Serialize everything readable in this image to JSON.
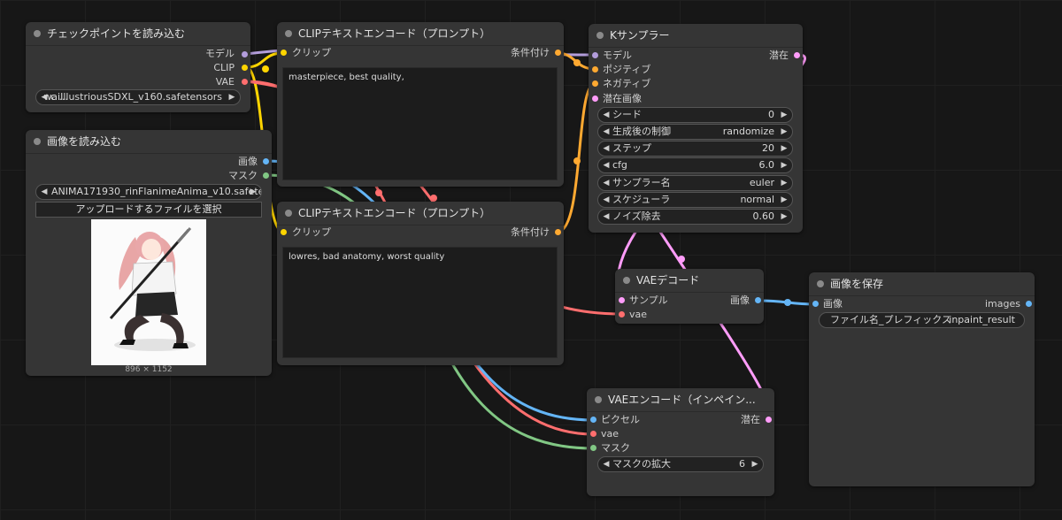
{
  "colors": {
    "model": "#b39ddb",
    "clip": "#ffd500",
    "vae": "#ff6e6e",
    "conditioning": "#ffa931",
    "latent": "#ff9cf9",
    "image": "#64b5f6",
    "mask": "#81c784"
  },
  "nodes": {
    "checkpoint": {
      "title": "チェックポイントを読み込む",
      "out_model": "モデル",
      "out_clip": "CLIP",
      "out_vae": "VAE",
      "ckpt_prefix": "c ...",
      "ckpt_value": "waiIllustriousSDXL_v160.safetensors"
    },
    "load_image": {
      "title": "画像を読み込む",
      "out_image": "画像",
      "out_mask": "マスク",
      "image_value": "ANIMA171930_rinFlanimeAnima_v10.safeten ...",
      "upload_label": "アップロードするファイルを選択",
      "caption": "896 × 1152"
    },
    "clip_pos": {
      "title": "CLIPテキストエンコード（プロンプト）",
      "in_clip": "クリップ",
      "out_cond": "条件付け",
      "text": "masterpiece, best quality,"
    },
    "clip_neg": {
      "title": "CLIPテキストエンコード（プロンプト）",
      "in_clip": "クリップ",
      "out_cond": "条件付け",
      "text": "lowres, bad anatomy, worst quality"
    },
    "ksampler": {
      "title": "Kサンプラー",
      "in_model": "モデル",
      "in_pos": "ポジティブ",
      "in_neg": "ネガティブ",
      "in_latent": "潜在画像",
      "out_latent": "潜在",
      "widgets": [
        {
          "label": "シード",
          "value": "0"
        },
        {
          "label": "生成後の制御",
          "value": "randomize"
        },
        {
          "label": "ステップ",
          "value": "20"
        },
        {
          "label": "cfg",
          "value": "6.0"
        },
        {
          "label": "サンプラー名",
          "value": "euler"
        },
        {
          "label": "スケジューラ",
          "value": "normal"
        },
        {
          "label": "ノイズ除去",
          "value": "0.60"
        }
      ]
    },
    "vae_decode": {
      "title": "VAEデコード",
      "in_samples": "サンプル",
      "in_vae": "vae",
      "out_image": "画像"
    },
    "save_image": {
      "title": "画像を保存",
      "in_images": "画像",
      "out_images": "images",
      "prefix_label": "ファイル名_プレフィックス",
      "prefix_value": "inpaint_result"
    },
    "vae_encode": {
      "title": "VAEエンコード（インペイン...",
      "in_pixels": "ピクセル",
      "in_vae": "vae",
      "in_mask": "マスク",
      "out_latent": "潜在",
      "grow_label": "マスクの拡大",
      "grow_value": "6"
    }
  }
}
